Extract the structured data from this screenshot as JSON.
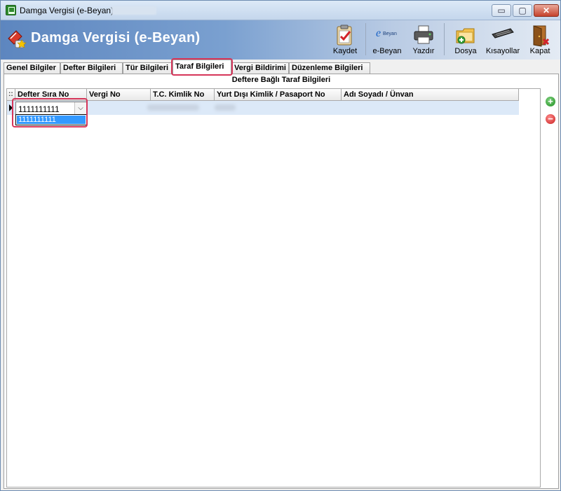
{
  "window": {
    "title": "Damga Vergisi (e-Beyan)",
    "controls": {
      "minimize": "▭",
      "maximize": "▢",
      "close": "✕"
    }
  },
  "header": {
    "title": "Damga Vergisi (e-Beyan)"
  },
  "toolbar": {
    "items": [
      {
        "label": "Kaydet",
        "icon": "save-clipboard-icon"
      },
      {
        "label": "e-Beyan",
        "icon": "e-beyan-icon",
        "icon_text": "Beyan"
      },
      {
        "label": "Yazdır",
        "icon": "printer-icon"
      },
      {
        "label": "Dosya",
        "icon": "folder-icon"
      },
      {
        "label": "Kısayollar",
        "icon": "keyboard-icon"
      },
      {
        "label": "Kapat",
        "icon": "exit-door-icon"
      }
    ]
  },
  "tabs": [
    {
      "label": "Genel Bilgiler",
      "active": false
    },
    {
      "label": "Defter Bilgileri",
      "active": false
    },
    {
      "label": "Tür Bilgileri",
      "active": false
    },
    {
      "label": "Taraf Bilgileri",
      "active": true
    },
    {
      "label": "Vergi Bildirimi",
      "active": false
    },
    {
      "label": "Düzenleme Bilgileri",
      "active": false
    }
  ],
  "section": {
    "title": "Deftere Bağlı Taraf Bilgileri"
  },
  "grid": {
    "grip": "::",
    "columns": [
      "Defter Sıra No",
      "Vergi No",
      "T.C. Kimlik No",
      "Yurt Dışı Kimlik / Pasaport No",
      "Adı Soyadı / Ünvan"
    ],
    "editor": {
      "value": "1111111111",
      "arrow": "⌵",
      "options": [
        "1111111111"
      ],
      "selected_option": "1111111111"
    }
  },
  "side_buttons": {
    "add": "+",
    "remove": "−"
  },
  "colors": {
    "highlight": "#d6365a",
    "selected_row": "#dce9f8",
    "dropdown_selected": "#3399ff"
  }
}
